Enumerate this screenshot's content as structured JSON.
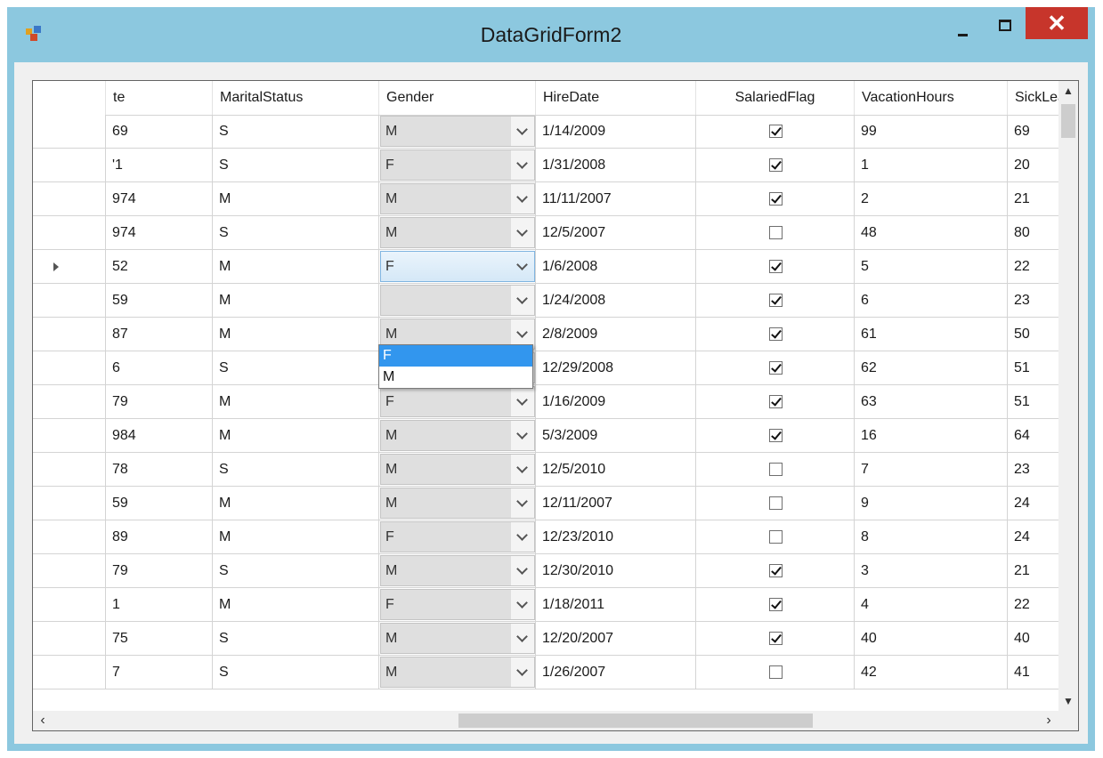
{
  "window": {
    "title": "DataGridForm2",
    "close_glyph": "✕"
  },
  "grid": {
    "columns": [
      "te",
      "MaritalStatus",
      "Gender",
      "HireDate",
      "SalariedFlag",
      "VacationHours",
      "SickLea"
    ],
    "current_row": 4,
    "rows": [
      {
        "c0": "69",
        "marital": "S",
        "gender": "M",
        "hire": "1/14/2009",
        "salaried": true,
        "vac": "99",
        "sick": "69"
      },
      {
        "c0": "'1",
        "marital": "S",
        "gender": "F",
        "hire": "1/31/2008",
        "salaried": true,
        "vac": "1",
        "sick": "20"
      },
      {
        "c0": "974",
        "marital": "M",
        "gender": "M",
        "hire": "11/11/2007",
        "salaried": true,
        "vac": "2",
        "sick": "21"
      },
      {
        "c0": "974",
        "marital": "S",
        "gender": "M",
        "hire": "12/5/2007",
        "salaried": false,
        "vac": "48",
        "sick": "80"
      },
      {
        "c0": "52",
        "marital": "M",
        "gender": "F",
        "hire": "1/6/2008",
        "salaried": true,
        "vac": "5",
        "sick": "22"
      },
      {
        "c0": "59",
        "marital": "M",
        "gender": "",
        "hire": "1/24/2008",
        "salaried": true,
        "vac": "6",
        "sick": "23"
      },
      {
        "c0": "87",
        "marital": "M",
        "gender": "M",
        "hire": "2/8/2009",
        "salaried": true,
        "vac": "61",
        "sick": "50"
      },
      {
        "c0": "6",
        "marital": "S",
        "gender": "F",
        "hire": "12/29/2008",
        "salaried": true,
        "vac": "62",
        "sick": "51"
      },
      {
        "c0": "79",
        "marital": "M",
        "gender": "F",
        "hire": "1/16/2009",
        "salaried": true,
        "vac": "63",
        "sick": "51"
      },
      {
        "c0": "984",
        "marital": "M",
        "gender": "M",
        "hire": "5/3/2009",
        "salaried": true,
        "vac": "16",
        "sick": "64"
      },
      {
        "c0": "78",
        "marital": "S",
        "gender": "M",
        "hire": "12/5/2010",
        "salaried": false,
        "vac": "7",
        "sick": "23"
      },
      {
        "c0": "59",
        "marital": "M",
        "gender": "M",
        "hire": "12/11/2007",
        "salaried": false,
        "vac": "9",
        "sick": "24"
      },
      {
        "c0": "89",
        "marital": "M",
        "gender": "F",
        "hire": "12/23/2010",
        "salaried": false,
        "vac": "8",
        "sick": "24"
      },
      {
        "c0": "79",
        "marital": "S",
        "gender": "M",
        "hire": "12/30/2010",
        "salaried": true,
        "vac": "3",
        "sick": "21"
      },
      {
        "c0": "1",
        "marital": "M",
        "gender": "F",
        "hire": "1/18/2011",
        "salaried": true,
        "vac": "4",
        "sick": "22"
      },
      {
        "c0": "75",
        "marital": "S",
        "gender": "M",
        "hire": "12/20/2007",
        "salaried": true,
        "vac": "40",
        "sick": "40"
      },
      {
        "c0": "7",
        "marital": "S",
        "gender": "M",
        "hire": "1/26/2007",
        "salaried": false,
        "vac": "42",
        "sick": "41"
      }
    ]
  },
  "dropdown": {
    "options": [
      "F",
      "M"
    ],
    "selected": "F"
  },
  "colors": {
    "titlebar": "#8cc8df",
    "close": "#c7352b",
    "selection": "#3296ee"
  },
  "icons": {
    "app": "winforms-app-icon",
    "checkbox_mark": "checkmark-icon",
    "combo_arrow": "chevron-down-icon"
  }
}
